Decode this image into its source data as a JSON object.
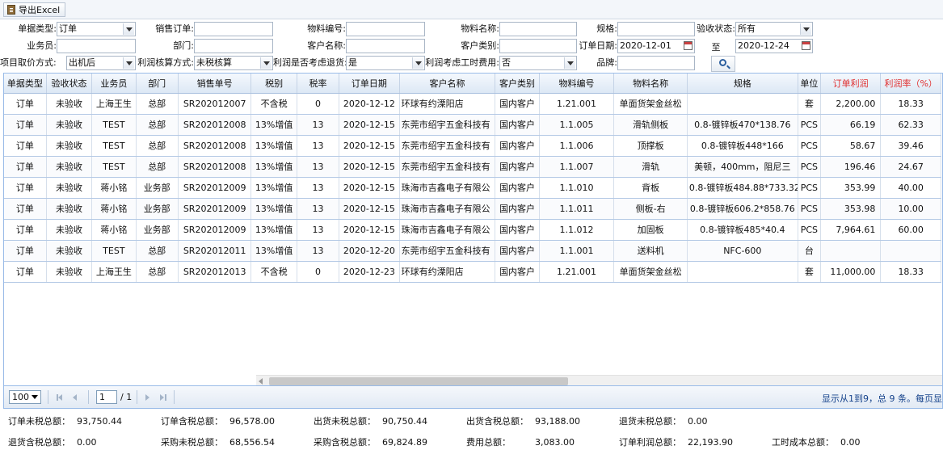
{
  "toolbar": {
    "export_label": "导出Excel"
  },
  "filters": {
    "doc_type": {
      "label": "单据类型:",
      "value": "订单"
    },
    "sales_order": {
      "label": "销售订单:",
      "value": ""
    },
    "material_code": {
      "label": "物料编号:",
      "value": ""
    },
    "material_name": {
      "label": "物料名称:",
      "value": ""
    },
    "spec": {
      "label": "规格:",
      "value": ""
    },
    "inspect_status": {
      "label": "验收状态:",
      "value": "所有"
    },
    "salesman": {
      "label": "业务员:",
      "value": ""
    },
    "department": {
      "label": "部门:",
      "value": ""
    },
    "customer_name": {
      "label": "客户名称:",
      "value": ""
    },
    "customer_type": {
      "label": "客户类别:",
      "value": ""
    },
    "order_date": {
      "label": "订单日期:",
      "from": "2020-12-01",
      "to_label": "至",
      "to": "2020-12-24"
    },
    "price_mode": {
      "label": "项目取价方式:",
      "value": "出机后"
    },
    "profit_mode": {
      "label": "利润核算方式:",
      "value": "未税核算"
    },
    "return_consider": {
      "label": "利润是否考虑退货:",
      "value": "是"
    },
    "labor_consider": {
      "label": "利润考虑工时费用:",
      "value": "否"
    },
    "brand": {
      "label": "品牌:",
      "value": ""
    }
  },
  "table": {
    "headers": [
      "单据类型",
      "验收状态",
      "业务员",
      "部门",
      "销售单号",
      "税别",
      "税率",
      "订单日期",
      "客户名称",
      "客户类别",
      "物料编号",
      "物料名称",
      "规格",
      "单位",
      "订单利润",
      "利润率（%）"
    ],
    "rows": [
      [
        "订单",
        "未验收",
        "上海王生",
        "总部",
        "SR202012007",
        "不含税",
        "0",
        "2020-12-12",
        "环球有约溧阳店",
        "国内客户",
        "1.21.001",
        "单面货架金丝松",
        "",
        "套",
        "2,200.00",
        "18.33"
      ],
      [
        "订单",
        "未验收",
        "TEST",
        "总部",
        "SR202012008",
        "13%增值",
        "13",
        "2020-12-15",
        "东莞市绍宇五金科技有",
        "国内客户",
        "1.1.005",
        "滑轨侧板",
        "0.8-镀锌板470*138.76",
        "PCS",
        "66.19",
        "62.33"
      ],
      [
        "订单",
        "未验收",
        "TEST",
        "总部",
        "SR202012008",
        "13%增值",
        "13",
        "2020-12-15",
        "东莞市绍宇五金科技有",
        "国内客户",
        "1.1.006",
        "顶撑板",
        "0.8-镀锌板448*166",
        "PCS",
        "58.67",
        "39.46"
      ],
      [
        "订单",
        "未验收",
        "TEST",
        "总部",
        "SR202012008",
        "13%增值",
        "13",
        "2020-12-15",
        "东莞市绍宇五金科技有",
        "国内客户",
        "1.1.007",
        "滑轨",
        "美顿，400mm，阻尼三",
        "PCS",
        "196.46",
        "24.67"
      ],
      [
        "订单",
        "未验收",
        "蒋小铭",
        "业务部",
        "SR202012009",
        "13%增值",
        "13",
        "2020-12-15",
        "珠海市吉鑫电子有限公",
        "国内客户",
        "1.1.010",
        "背板",
        "0.8-镀锌板484.88*733.32",
        "PCS",
        "353.99",
        "40.00"
      ],
      [
        "订单",
        "未验收",
        "蒋小铭",
        "业务部",
        "SR202012009",
        "13%增值",
        "13",
        "2020-12-15",
        "珠海市吉鑫电子有限公",
        "国内客户",
        "1.1.011",
        "侧板-右",
        "0.8-镀锌板606.2*858.76",
        "PCS",
        "353.98",
        "10.00"
      ],
      [
        "订单",
        "未验收",
        "蒋小铭",
        "业务部",
        "SR202012009",
        "13%增值",
        "13",
        "2020-12-15",
        "珠海市吉鑫电子有限公",
        "国内客户",
        "1.1.012",
        "加固板",
        "0.8-镀锌板485*40.4",
        "PCS",
        "7,964.61",
        "60.00"
      ],
      [
        "订单",
        "未验收",
        "TEST",
        "总部",
        "SR202012011",
        "13%增值",
        "13",
        "2020-12-20",
        "东莞市绍宇五金科技有",
        "国内客户",
        "1.1.001",
        "送料机",
        "NFC-600",
        "台",
        "",
        ""
      ],
      [
        "订单",
        "未验收",
        "上海王生",
        "总部",
        "SR202012013",
        "不含税",
        "0",
        "2020-12-23",
        "环球有约溧阳店",
        "国内客户",
        "1.21.001",
        "单面货架金丝松",
        "",
        "套",
        "11,000.00",
        "18.33"
      ]
    ]
  },
  "pager": {
    "page_size": "100",
    "page": "1",
    "total_pages": "/ 1",
    "info": "显示从1到9，总 9 条。每页显"
  },
  "summary": [
    {
      "label": "订单未税总额：",
      "value": "93,750.44"
    },
    {
      "label": "订单含税总额：",
      "value": "96,578.00"
    },
    {
      "label": "出货未税总额：",
      "value": "90,750.44"
    },
    {
      "label": "出货含税总额：",
      "value": "93,188.00"
    },
    {
      "label": "退货未税总额：",
      "value": "0.00"
    },
    {
      "label": "退货含税总额：",
      "value": "0.00"
    },
    {
      "label": "采购未税总额：",
      "value": "68,556.54"
    },
    {
      "label": "采购含税总额：",
      "value": "69,824.89"
    },
    {
      "label": "费用总额：",
      "value": "3,083.00"
    },
    {
      "label": "订单利润总额：",
      "value": "22,193.90"
    },
    {
      "label": "工时成本总额：",
      "value": "0.00"
    }
  ]
}
